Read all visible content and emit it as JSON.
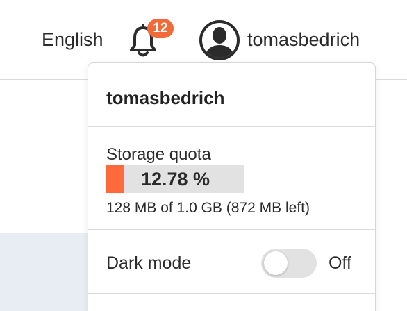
{
  "topbar": {
    "language": "English",
    "notifications": {
      "icon": "bell-icon",
      "count": "12"
    },
    "user": {
      "avatar_icon": "user-avatar-icon",
      "username": "tomasbedrich"
    }
  },
  "dropdown": {
    "username": "tomasbedrich",
    "storage": {
      "title": "Storage quota",
      "percent_label": "12.78 %",
      "used_fraction": 0.1278,
      "detail": "128 MB of 1.0 GB (872 MB left)"
    },
    "dark_mode": {
      "label": "Dark mode",
      "state": "Off",
      "enabled": false
    }
  },
  "colors": {
    "accent": "#ff6a3d",
    "badge": "#f06a3a",
    "bar_track": "#e2e2e2",
    "toggle_off": "#e2e2e2"
  }
}
